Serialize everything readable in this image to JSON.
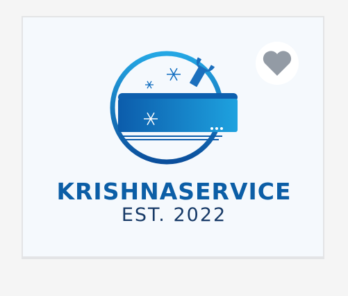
{
  "logo": {
    "brand_name": "KRISHNASERVICE",
    "established": "EST. 2022",
    "emblem_icon": "ac-unit-wrench-icon"
  },
  "favorite": {
    "icon": "heart-icon"
  },
  "colors": {
    "brand_blue": "#0c5ea6",
    "est_navy": "#173a67",
    "heart_gray": "#939ba5",
    "card_bg": "#f5f9fd"
  }
}
